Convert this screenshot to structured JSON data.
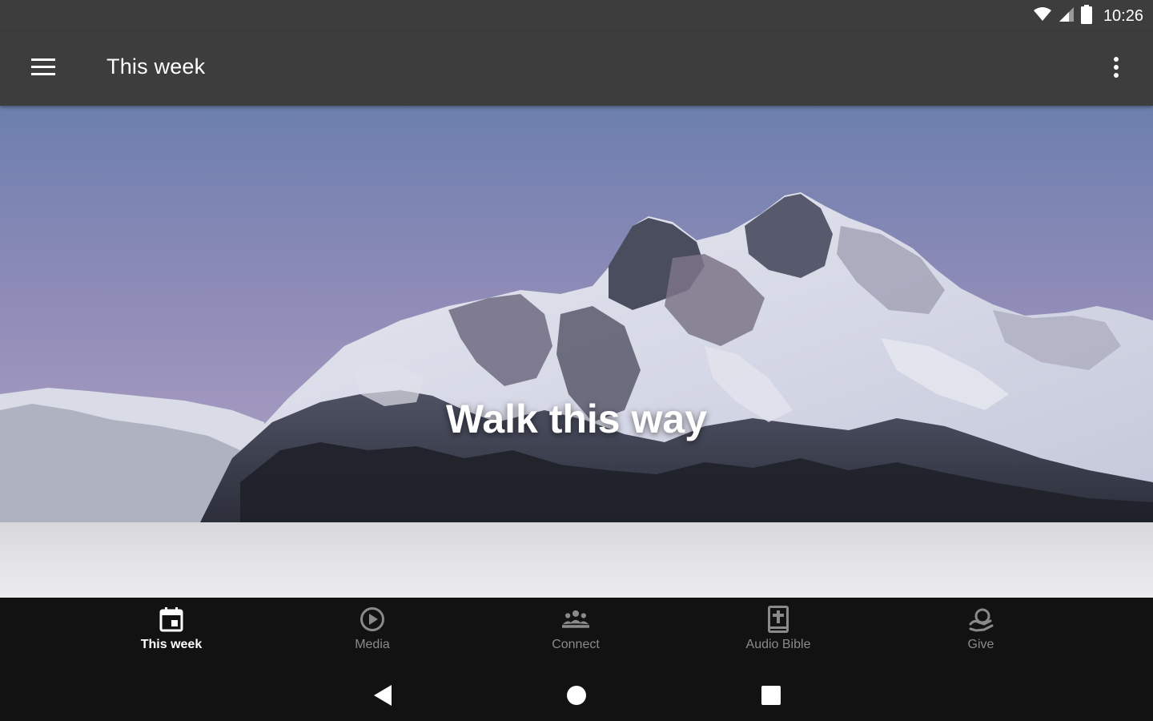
{
  "status_bar": {
    "time": "10:26",
    "icons": [
      "wifi-icon",
      "cell-signal-icon",
      "battery-icon"
    ]
  },
  "app_bar": {
    "title": "This week",
    "menu_icon": "hamburger-menu-icon",
    "overflow_icon": "more-vertical-icon"
  },
  "hero": {
    "title": "Walk this way",
    "image": "snowy-mountain-peak"
  },
  "bottom_nav": {
    "items": [
      {
        "label": "This week",
        "icon": "calendar-icon",
        "active": true
      },
      {
        "label": "Media",
        "icon": "play-circle-icon",
        "active": false
      },
      {
        "label": "Connect",
        "icon": "group-icon",
        "active": false
      },
      {
        "label": "Audio Bible",
        "icon": "bible-icon",
        "active": false
      },
      {
        "label": "Give",
        "icon": "give-hand-icon",
        "active": false
      }
    ]
  },
  "system_nav": {
    "buttons": [
      "back-icon",
      "home-icon",
      "recents-icon"
    ]
  },
  "colors": {
    "toolbar": "#3d3d3d",
    "nav_background": "#121212",
    "active_label": "#ffffff",
    "inactive_label": "#8a8a8a"
  }
}
